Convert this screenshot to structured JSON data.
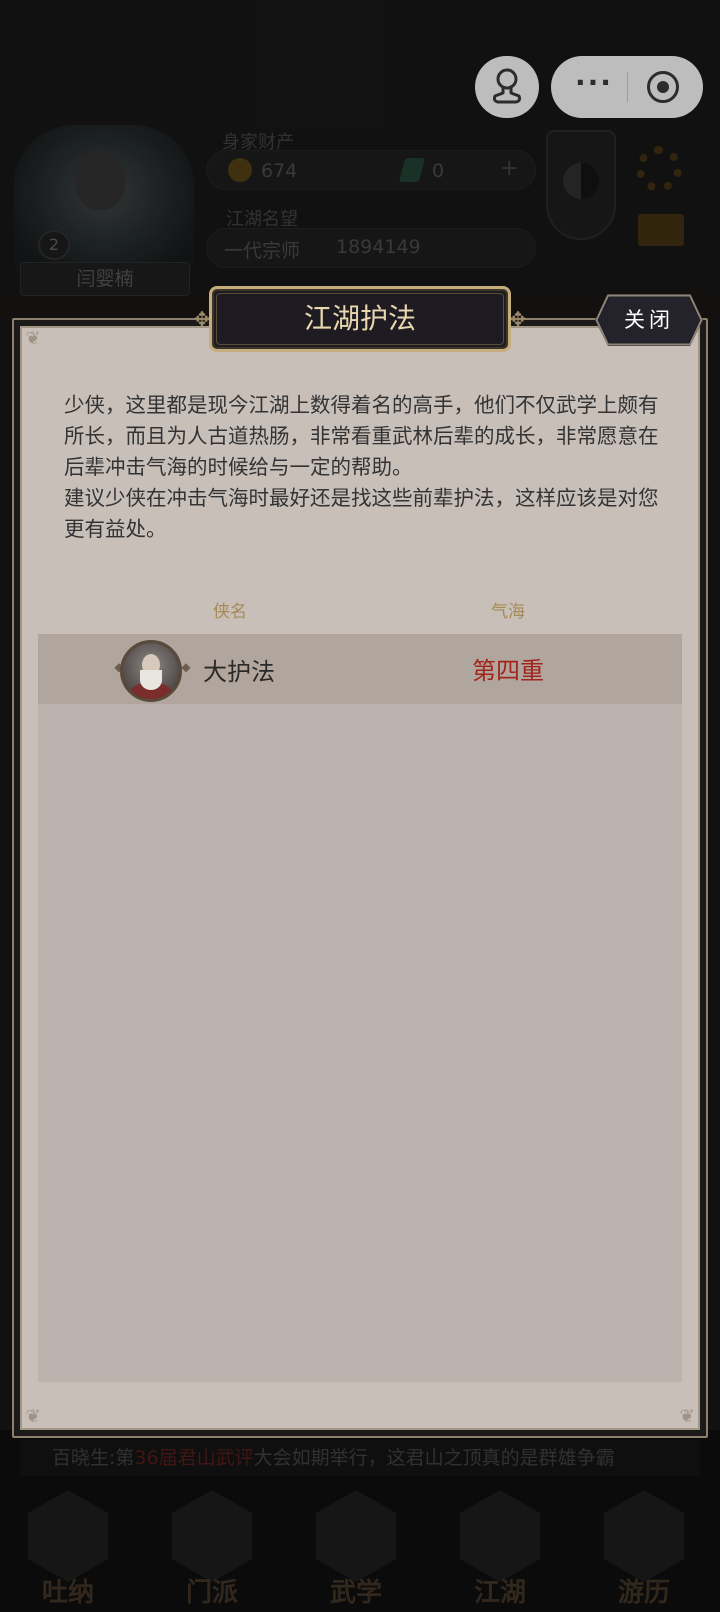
{
  "background": {
    "player_level": "2",
    "player_name": "闫婴楠",
    "assets_label": "身家财产",
    "coins_value": "674",
    "jade_value": "0",
    "plus_label": "+",
    "reputation_label": "江湖名望",
    "reputation_title": "一代宗师",
    "reputation_value": "1894149",
    "ticker_prefix": "百晓生:第",
    "ticker_highlight": "36届君山武评",
    "ticker_suffix": "大会如期举行，这君山之顶真的是群雄争霸",
    "nav": [
      "吐纳",
      "门派",
      "武学",
      "江湖",
      "游历"
    ]
  },
  "capsule": {
    "more_label": "···"
  },
  "dialog": {
    "title": "江湖护法",
    "close_label": "关闭",
    "description_p1": "少侠，这里都是现今江湖上数得着名的高手，他们不仅武学上颇有所长，而且为人古道热肠，非常看重武林后辈的成长，非常愿意在后辈冲击气海的时候给与一定的帮助。",
    "description_p2": "建议少侠在冲击气海时最好还是找这些前辈护法，这样应该是对您更有益处。",
    "columns": {
      "name": "侠名",
      "qihai": "气海"
    },
    "protectors": [
      {
        "name": "大护法",
        "qihai": "第四重"
      }
    ]
  },
  "colors": {
    "title_text": "#e8d6ae",
    "qihai_text": "#a3241c",
    "column_header": "#a58a55",
    "panel_bg": "#c8bfb9"
  }
}
